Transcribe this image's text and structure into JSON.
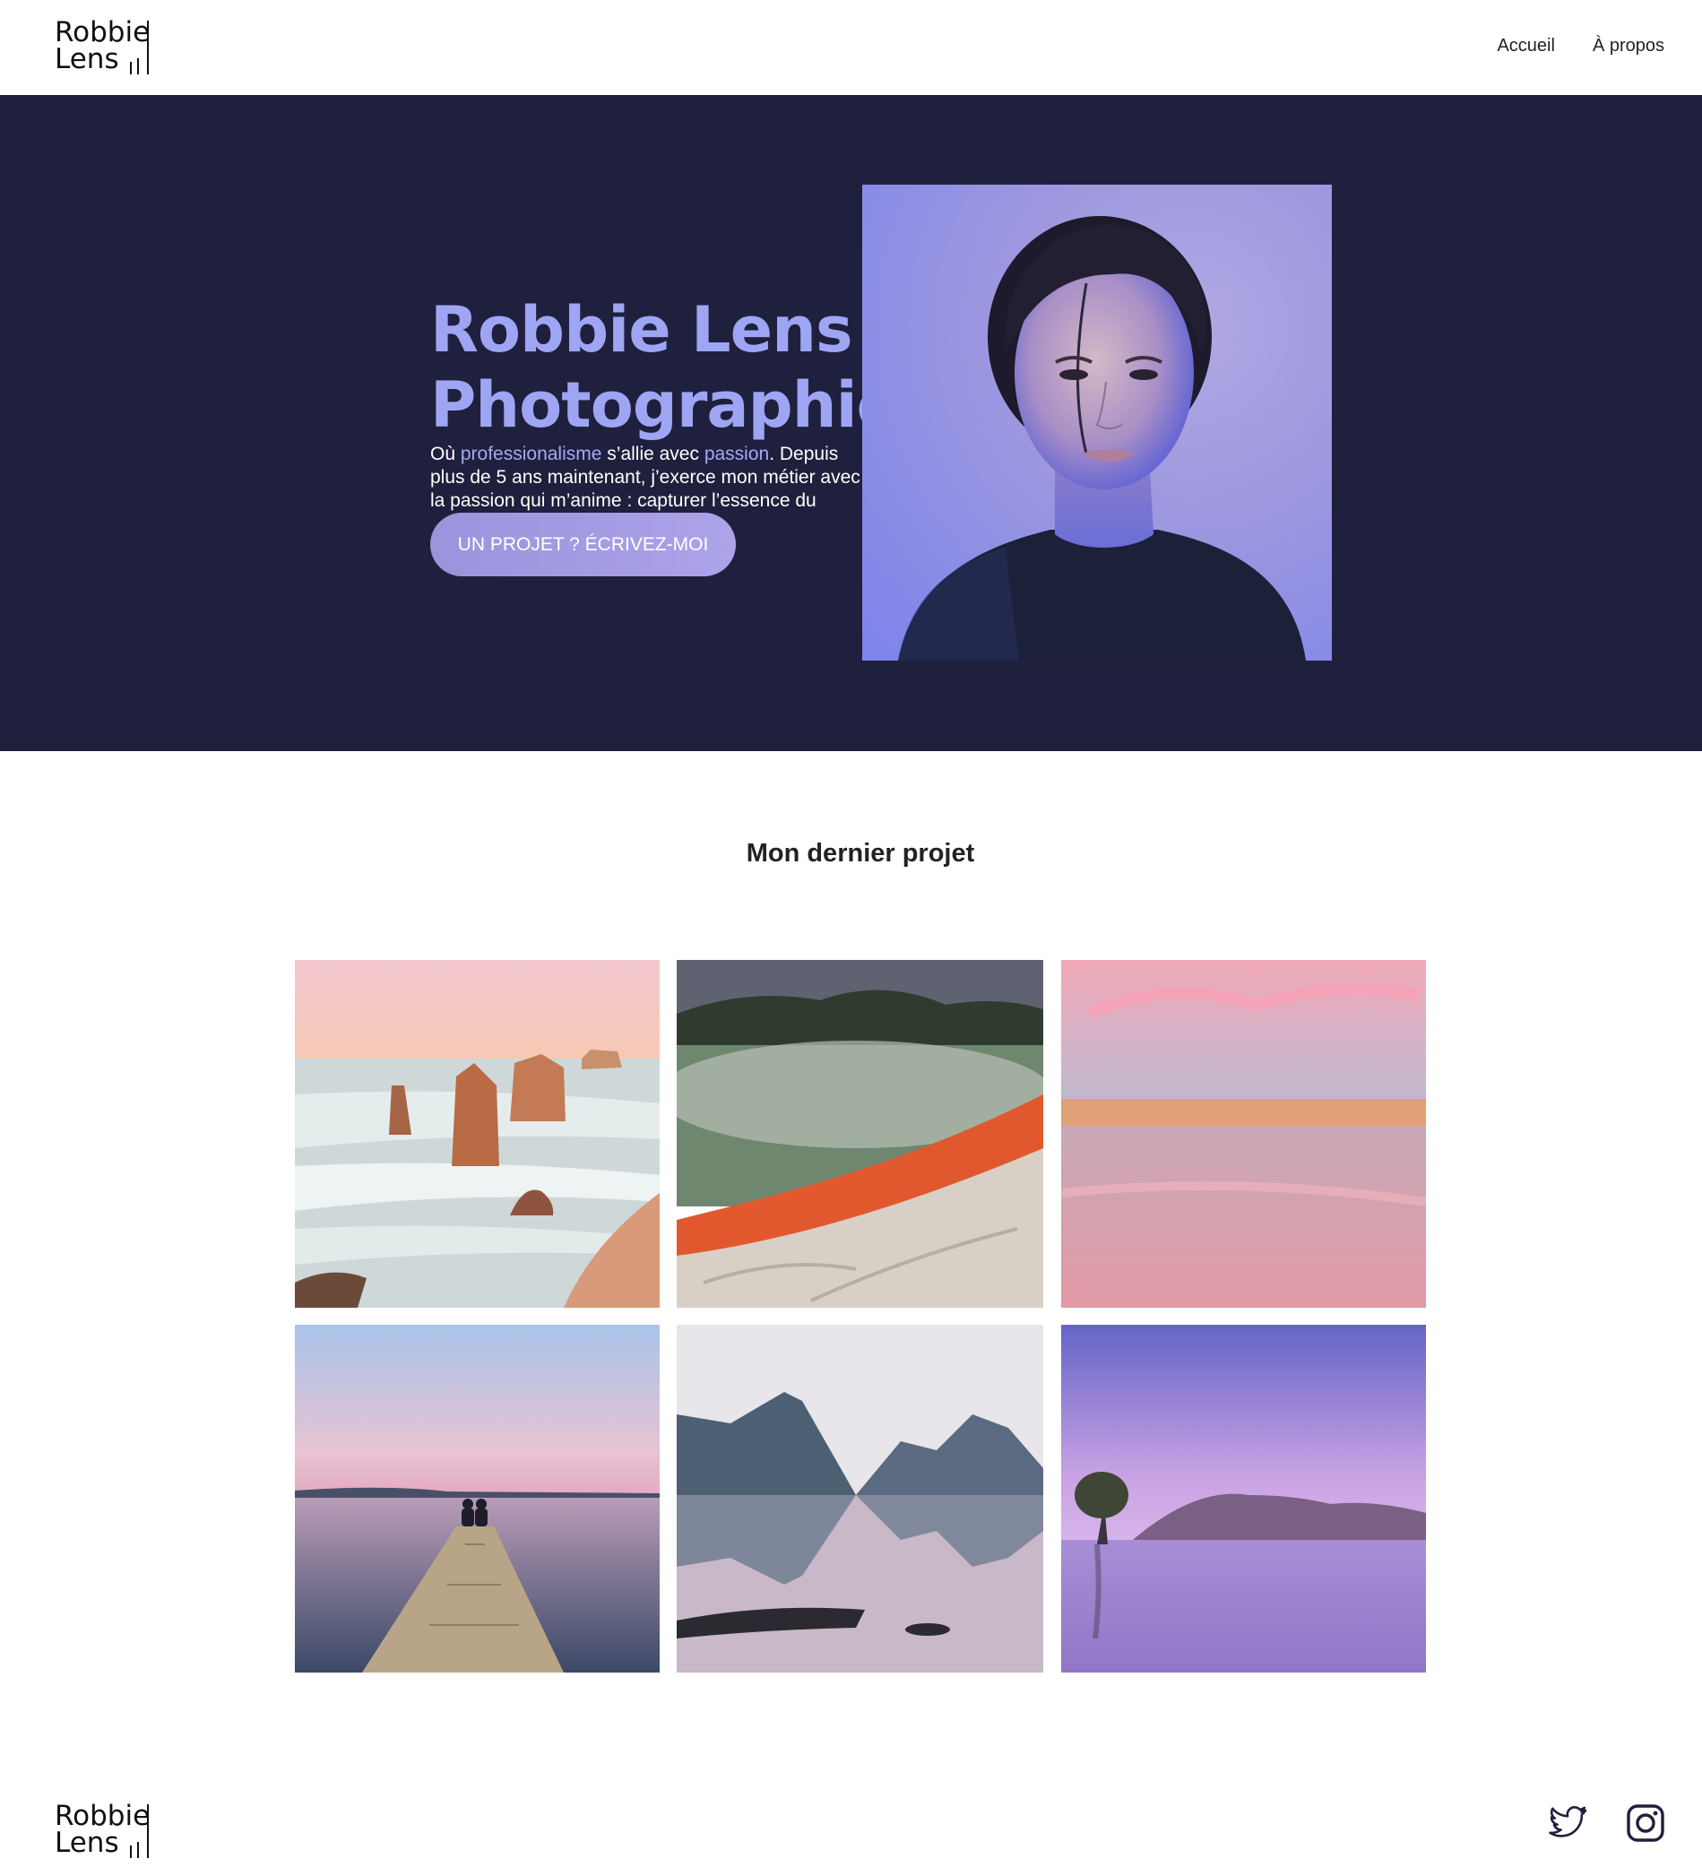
{
  "header": {
    "logo": {
      "line1": "Robbie",
      "line2": "Lens"
    },
    "nav": [
      {
        "label": "Accueil"
      },
      {
        "label": "À propos"
      }
    ]
  },
  "hero": {
    "title_line1": "Robbie Lens",
    "title_line2": "Photographie",
    "text": {
      "part1": "Où ",
      "accent1": "professionalisme",
      "part2": " s’allie avec ",
      "accent2": "passion",
      "part3": ". Depuis plus de 5 ans maintenant, j’exerce mon métier avec la passion qui m’anime : capturer l’essence du"
    },
    "cta_label": "UN PROJET ? ÉCRIVEZ-MOI"
  },
  "projects": {
    "title": "Mon dernier projet"
  },
  "footer": {
    "logo": {
      "line1": "Robbie",
      "line2": "Lens"
    },
    "social": [
      {
        "icon": "twitter-icon"
      },
      {
        "icon": "instagram-icon"
      }
    ]
  },
  "colors": {
    "hero_bg": "#1f203d",
    "accent": "#9ea5f3",
    "cta": "#a49ce4"
  }
}
